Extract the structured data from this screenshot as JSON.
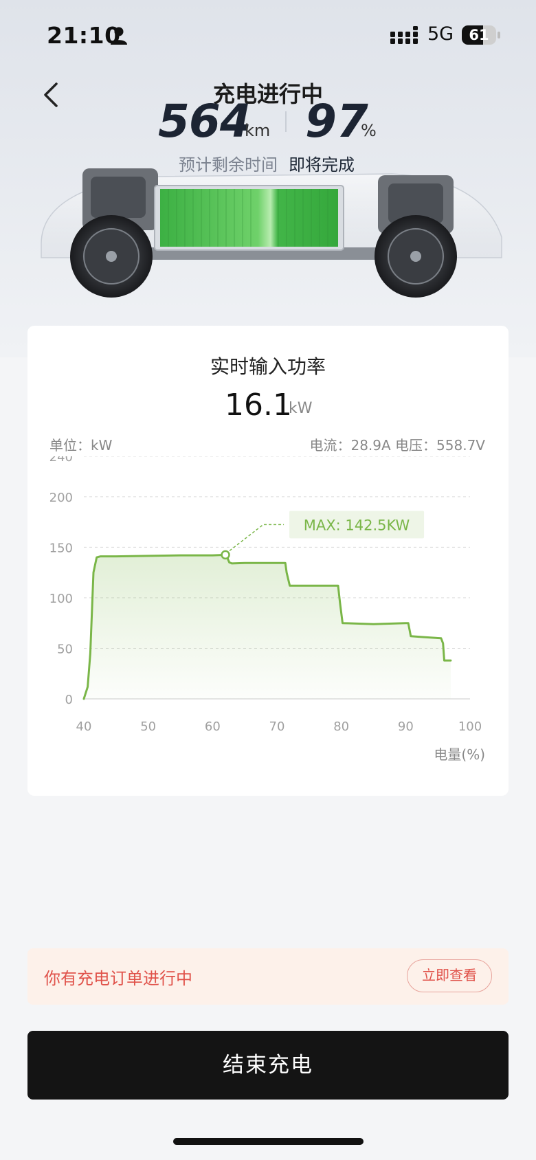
{
  "status_bar": {
    "time": "21:10",
    "network": "5G",
    "battery": "61"
  },
  "header": {
    "title": "充电进行中",
    "range_value": "564",
    "range_unit": "km",
    "soc_value": "97",
    "soc_unit": "%",
    "eta_label": "预计剩余时间",
    "eta_value": "即将完成"
  },
  "power_card": {
    "title": "实时输入功率",
    "value": "16.1",
    "unit": "kW",
    "unit_label": "单位：kW",
    "current_voltage": "电流：28.9A   电压：558.7V"
  },
  "chart_data": {
    "type": "line",
    "title": "",
    "xlabel": "电量(%)",
    "ylabel": "",
    "xlim": [
      40,
      100
    ],
    "ylim": [
      0,
      240
    ],
    "x_ticks": [
      40,
      50,
      60,
      70,
      80,
      90,
      100
    ],
    "y_ticks": [
      0,
      50,
      100,
      150,
      200,
      240
    ],
    "grid": true,
    "series": [
      {
        "x": [
          40,
          40.6,
          41,
          41.5,
          42,
          42.6,
          45,
          50,
          55,
          60,
          62,
          62.2,
          62.4,
          62.6,
          63,
          65,
          70,
          71.3,
          71.5,
          72,
          75,
          79,
          79.5,
          79.8,
          80.2,
          85,
          90,
          90.4,
          90.8,
          93,
          95.5,
          95.8,
          96,
          97
        ],
        "y": [
          0,
          12,
          45,
          125,
          140,
          141,
          141,
          141.5,
          142,
          142,
          142.5,
          142,
          138,
          135,
          134,
          134.5,
          134.5,
          134.5,
          125,
          112,
          112,
          112,
          112,
          95,
          75,
          74,
          75,
          75,
          62,
          61,
          60,
          55,
          38,
          38
        ]
      }
    ],
    "annotation": {
      "text": "MAX: 142.5KW",
      "x": 62,
      "y": 142.5
    },
    "colors": {
      "line": "#7ab648",
      "annotation_bg": "#eef5e7",
      "annotation_text": "#7ab648"
    }
  },
  "order_banner": {
    "text": "你有充电订单进行中",
    "button": "立即查看"
  },
  "end_button": "结束充电"
}
